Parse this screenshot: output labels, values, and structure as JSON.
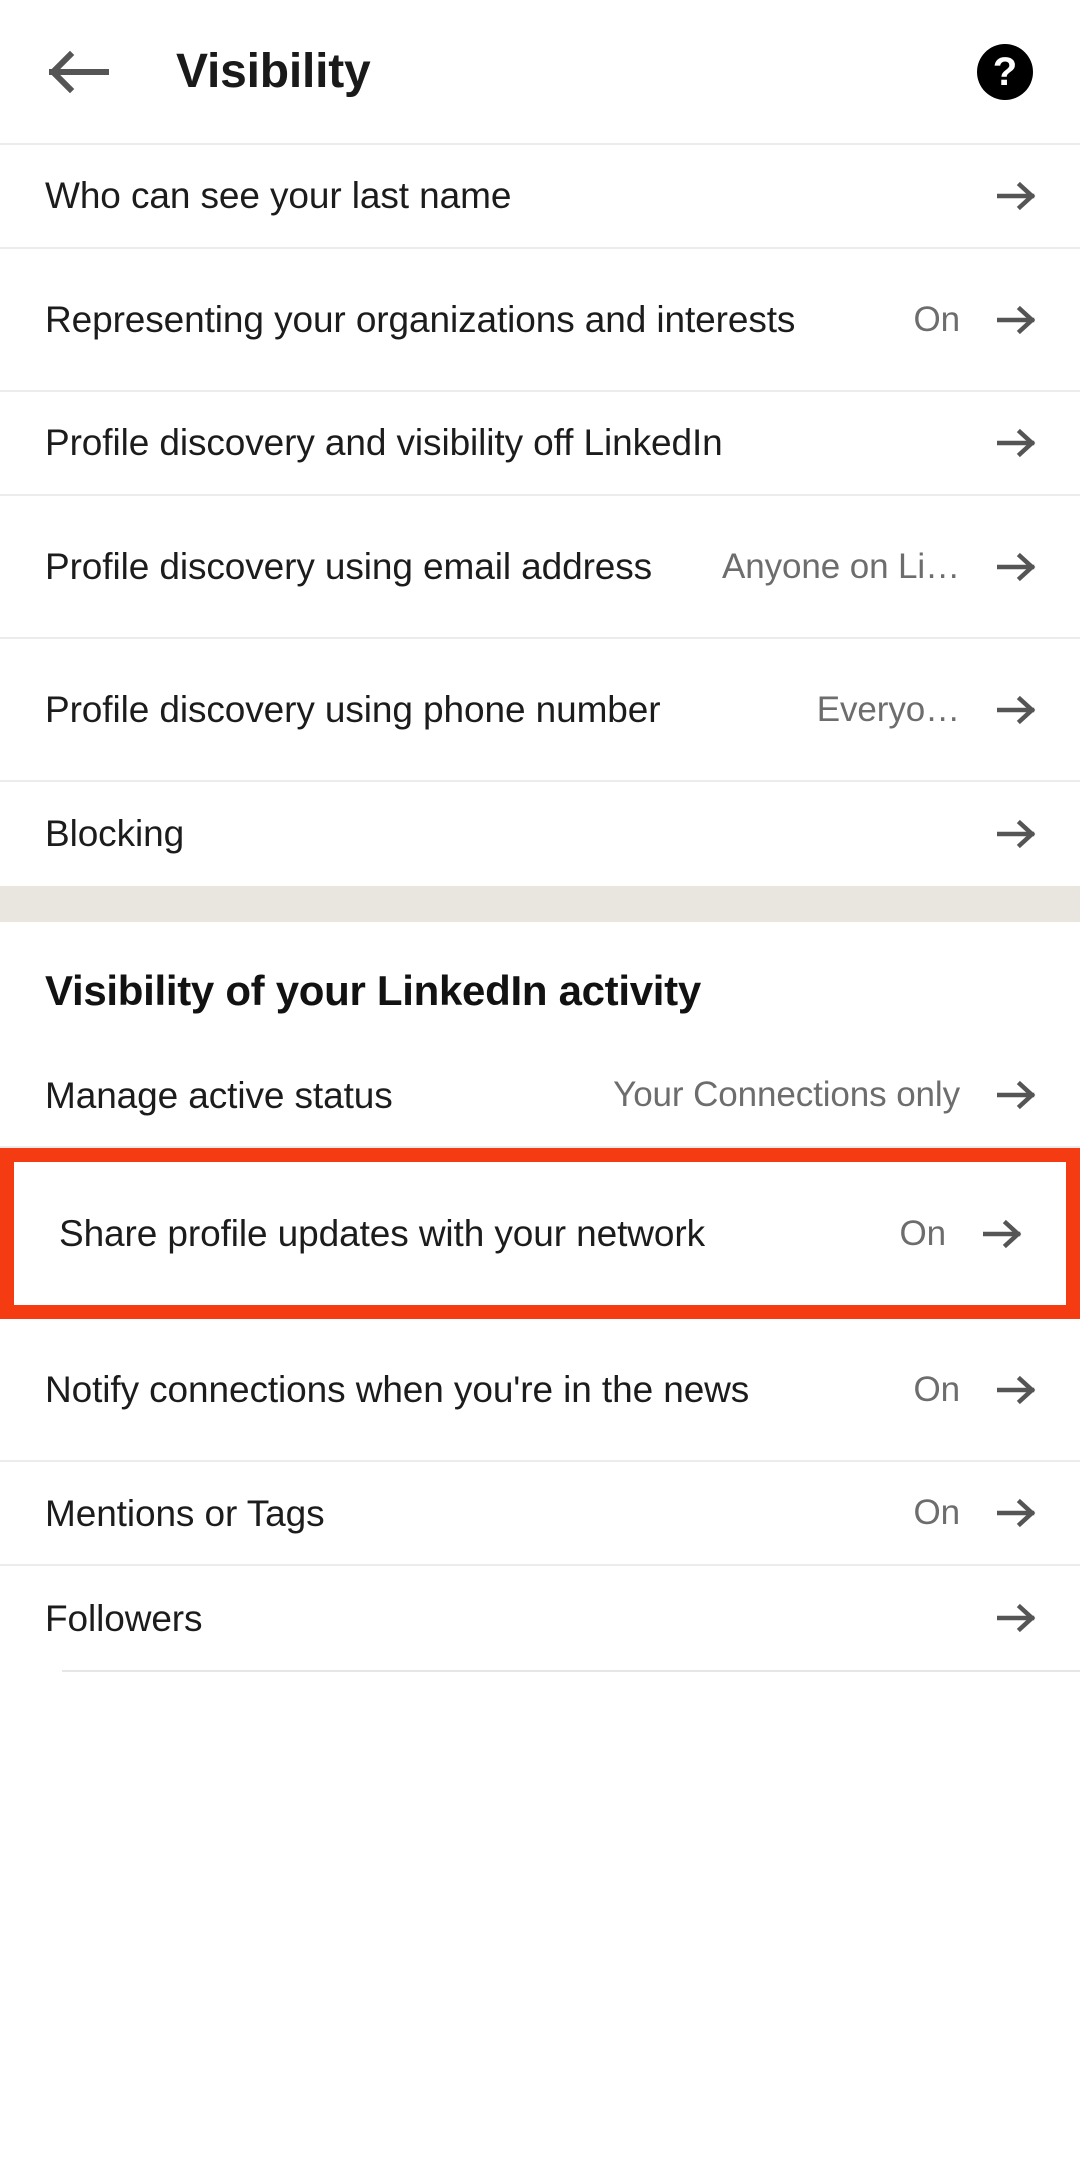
{
  "header": {
    "title": "Visibility",
    "back_icon": "back-arrow-icon",
    "help_icon": "help-circle-icon",
    "help_glyph": "?"
  },
  "colors": {
    "highlight": "#f43b11",
    "band": "#e8e6de",
    "value_text": "#6d6d6d",
    "label_text": "#1c1c1c",
    "chevron": "#555555"
  },
  "sections": [
    {
      "id": "profile-visibility",
      "heading": null,
      "rows": [
        {
          "label": "Who can see your last name",
          "value": "",
          "lines": 1,
          "highlighted": false
        },
        {
          "label": "Representing your organizations and interests",
          "value": "On",
          "lines": 2,
          "highlighted": false
        },
        {
          "label": "Profile discovery and visibility off LinkedIn",
          "value": "",
          "lines": 1,
          "highlighted": false
        },
        {
          "label": "Profile discovery using email address",
          "value": "Anyone on Li…",
          "lines": 2,
          "highlighted": false
        },
        {
          "label": "Profile discovery using phone number",
          "value": "Everyo…",
          "lines": 2,
          "highlighted": false
        },
        {
          "label": "Blocking",
          "value": "",
          "lines": 1,
          "highlighted": false
        }
      ]
    },
    {
      "id": "activity-visibility",
      "heading": "Visibility of your LinkedIn activity",
      "rows": [
        {
          "label": "Manage active status",
          "value": "Your Connections only",
          "lines": 1,
          "highlighted": false
        },
        {
          "label": "Share profile updates with your network",
          "value": "On",
          "lines": 2,
          "highlighted": true
        },
        {
          "label": "Notify connections when you're in the news",
          "value": "On",
          "lines": 2,
          "highlighted": false
        },
        {
          "label": "Mentions or Tags",
          "value": "On",
          "lines": 1,
          "highlighted": false
        },
        {
          "label": "Followers",
          "value": "",
          "lines": 1,
          "highlighted": false
        }
      ]
    }
  ]
}
